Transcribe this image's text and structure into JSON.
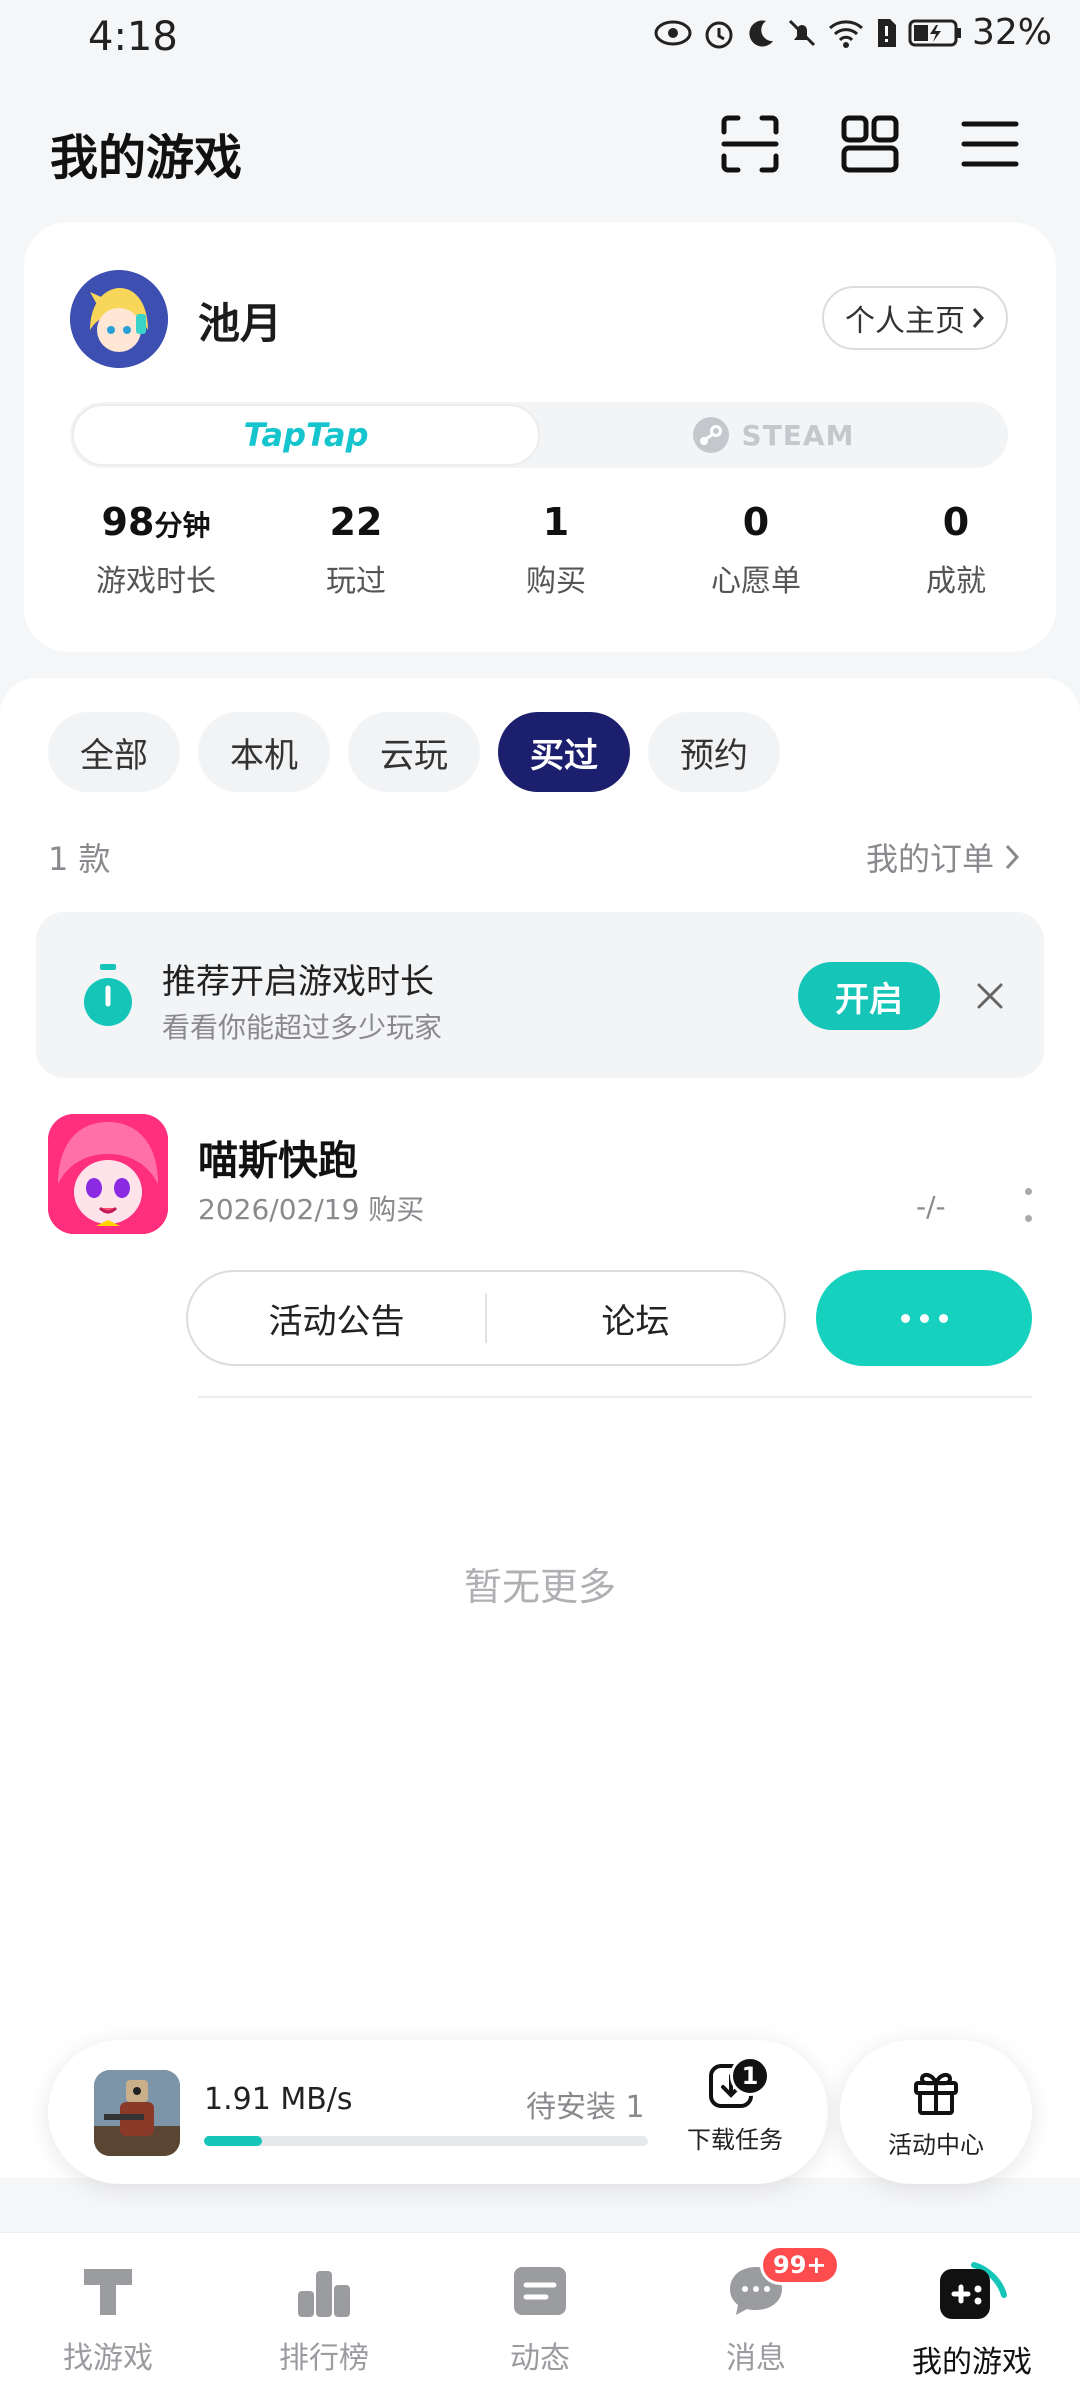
{
  "status_bar": {
    "time": "4:18",
    "battery": "32%"
  },
  "header": {
    "title": "我的游戏"
  },
  "profile": {
    "username": "池月",
    "homepage_label": "个人主页",
    "platforms": {
      "taptap": "TapTap",
      "steam": "STEAM"
    },
    "stats": [
      {
        "value": "98",
        "unit": "分钟",
        "label": "游戏时长"
      },
      {
        "value": "22",
        "unit": "",
        "label": "玩过"
      },
      {
        "value": "1",
        "unit": "",
        "label": "购买"
      },
      {
        "value": "0",
        "unit": "",
        "label": "心愿单"
      },
      {
        "value": "0",
        "unit": "",
        "label": "成就"
      }
    ]
  },
  "filters": {
    "chips": [
      "全部",
      "本机",
      "云玩",
      "买过",
      "预约"
    ],
    "active": "买过",
    "count_text": "1 款",
    "orders_link": "我的订单"
  },
  "banner": {
    "title": "推荐开启游戏时长",
    "subtitle": "看看你能超过多少玩家",
    "button": "开启"
  },
  "game": {
    "name": "喵斯快跑",
    "date": "2026/02/19 购买",
    "score": "-/-",
    "actions": [
      "活动公告",
      "论坛"
    ]
  },
  "list_footer": "暂无更多",
  "download": {
    "speed": "1.91 MB/s",
    "pending": "待安装 1",
    "progress": 0.13,
    "task_label": "下载任务",
    "task_badge": "1"
  },
  "events": {
    "label": "活动中心"
  },
  "bottom_nav": {
    "items": [
      "找游戏",
      "排行榜",
      "动态",
      "消息",
      "我的游戏"
    ],
    "active": "我的游戏",
    "message_badge": "99+"
  },
  "colors": {
    "accent": "#15c5b8",
    "active_chip": "#1c1f6e",
    "badge": "#ff4d4f"
  }
}
